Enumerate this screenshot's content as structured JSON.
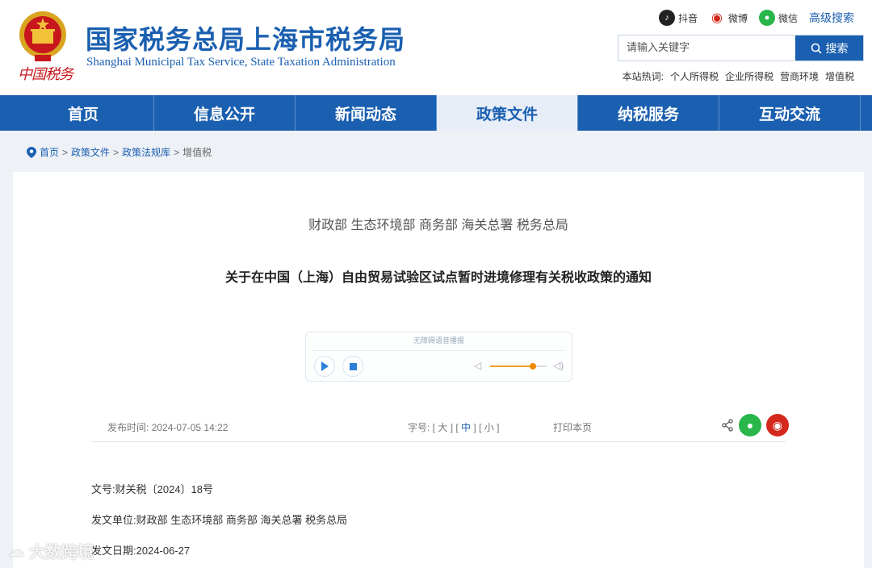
{
  "header": {
    "title_cn": "国家税务总局上海市税务局",
    "title_en": "Shanghai Municipal Tax Service, State Taxation Administration",
    "seal_text": "中国税务",
    "social": [
      {
        "label": "抖音",
        "icon": "douyin-icon"
      },
      {
        "label": "微博",
        "icon": "weibo-icon"
      },
      {
        "label": "微信",
        "icon": "wechat-icon"
      }
    ],
    "advanced_search": "高级搜索",
    "search": {
      "placeholder": "请输入关键字",
      "button": "搜索"
    },
    "hot_label": "本站热词:",
    "hot_words": [
      "个人所得税",
      "企业所得税",
      "营商环境",
      "增值税"
    ]
  },
  "nav": {
    "items": [
      "首页",
      "信息公开",
      "新闻动态",
      "政策文件",
      "纳税服务",
      "互动交流"
    ],
    "active_index": 3
  },
  "breadcrumb": [
    "首页",
    "政策文件",
    "政策法规库",
    "增值税"
  ],
  "article": {
    "issuer": "财政部 生态环境部 商务部 海关总署 税务总局",
    "title": "关于在中国（上海）自由贸易试验区试点暂时进境修理有关税收政策的通知",
    "player": {
      "label": "无障碍语音播报",
      "volume": 0.75
    },
    "publish_label": "发布时间:",
    "publish_time": "2024-07-05 14:22",
    "font_label": "字号:",
    "font_sizes": [
      "大",
      "中",
      "小"
    ],
    "print": "打印本页",
    "doc_no_label": "文号:",
    "doc_no": "财关税〔2024〕18号",
    "unit_label": "发文单位:",
    "unit": "财政部 生态环境部 商务部 海关总署 税务总局",
    "date_label": "发文日期:",
    "date": "2024-06-27"
  },
  "watermark": "大数跨境",
  "colors": {
    "brand": "#1a5fb0",
    "accent": "#f08a00",
    "wechat": "#29b64a",
    "weibo": "#d5281c"
  }
}
